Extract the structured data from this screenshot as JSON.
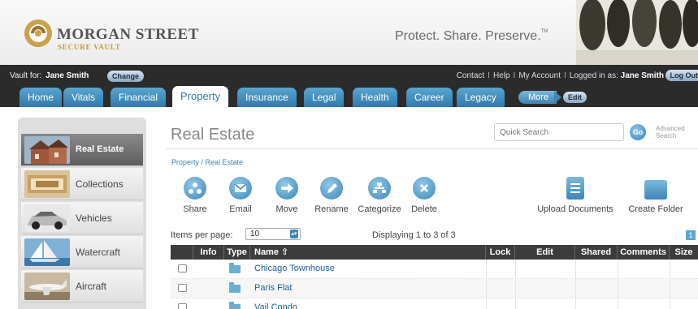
{
  "brand": {
    "name": "MORGAN STREET",
    "sub": "SECURE VAULT",
    "tagline": "Protect. Share. Preserve.",
    "tm": "TM"
  },
  "topbar": {
    "vault_for": "Vault for:",
    "owner": "Jane Smith",
    "change": "Change",
    "contact": "Contact",
    "help": "Help",
    "my_account": "My Account",
    "logged_in_as": "Logged in as:",
    "user": "Jane Smith",
    "logout": "Log Out"
  },
  "tabs": [
    "Home",
    "Vitals",
    "Financial",
    "Property",
    "Insurance",
    "Legal",
    "Health",
    "Career",
    "Legacy"
  ],
  "more": "More",
  "edit": "Edit",
  "sidebar": [
    {
      "label": "Real Estate",
      "icon": "house-photo"
    },
    {
      "label": "Collections",
      "icon": "collections-photo"
    },
    {
      "label": "Vehicles",
      "icon": "car-photo"
    },
    {
      "label": "Watercraft",
      "icon": "sailboat-photo"
    },
    {
      "label": "Aircraft",
      "icon": "airplane-photo"
    }
  ],
  "main": {
    "title": "Real Estate",
    "search_placeholder": "Quick Search",
    "go": "Go",
    "advanced_search": "Advanced Search",
    "breadcrumb": "Property / Real Estate"
  },
  "actions": [
    "Share",
    "Email",
    "Move",
    "Rename",
    "Categorize",
    "Delete",
    "Upload Documents",
    "Create Folder"
  ],
  "paging": {
    "items_label": "Items per page:",
    "items_value": "10",
    "displaying": "Displaying 1 to 3 of 3",
    "page": "1"
  },
  "table": {
    "columns": [
      "Info",
      "Type",
      "Name",
      "Lock",
      "Edit",
      "Shared",
      "Comments",
      "Size"
    ],
    "rows": [
      {
        "name": "Chicago Townhouse"
      },
      {
        "name": "Paris Flat"
      },
      {
        "name": "Vail Condo"
      }
    ]
  },
  "colors": {
    "accent": "#3f85b4",
    "link": "#1d5fa0",
    "dark_bar": "#2b2b2b"
  }
}
